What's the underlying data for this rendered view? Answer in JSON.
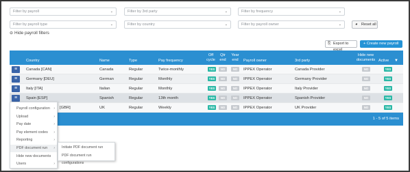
{
  "filters": {
    "payroll": "Filter by payroll",
    "third_party": "Filter by 3rd party",
    "frequency": "Filter by frequency",
    "payroll_type": "Filter by payroll type",
    "country": "Filter by country",
    "owner": "Filter by payroll owner"
  },
  "reset_label": "Reset all",
  "hide_filters_label": "Hide payroll filters",
  "export_label": "Export to excel",
  "create_label": "+ Create new payroll",
  "columns": {
    "country": "Country",
    "name": "Name",
    "type": "Type",
    "frequency": "Pay frequency",
    "off_cycle": "Off cycle",
    "qtr_end": "Qtr end",
    "year_end": "Year end",
    "owner": "Payroll owner",
    "third_party": "3rd party",
    "hide_new_docs": "Hide new documents",
    "active": "Active"
  },
  "rows": [
    {
      "country": "Canada [CAN]",
      "name": "Canada",
      "type": "Regular",
      "frequency": "Twice-monthly",
      "off_cycle": "YES",
      "qtr_end": "NO",
      "year_end": "NO",
      "owner": "IPPEX Operator",
      "third_party": "Canada Provider",
      "hide_new_docs": "NO",
      "active": "YES"
    },
    {
      "country": "Germany [DEU]",
      "name": "German",
      "type": "Regular",
      "frequency": "Monthly",
      "off_cycle": "YES",
      "qtr_end": "NO",
      "year_end": "NO",
      "owner": "IPPEX Operator",
      "third_party": "Germany Provider",
      "hide_new_docs": "NO",
      "active": "YES"
    },
    {
      "country": "Italy [ITA]",
      "name": "Italian",
      "type": "Regular",
      "frequency": "Monthly",
      "off_cycle": "YES",
      "qtr_end": "NO",
      "year_end": "NO",
      "owner": "IPPEX Operator",
      "third_party": "Italy Provider",
      "hide_new_docs": "NO",
      "active": "YES"
    },
    {
      "country": "Spain [ESP]",
      "name": "Spanish",
      "type": "Regular",
      "frequency": "13th month",
      "off_cycle": "YES",
      "qtr_end": "NO",
      "year_end": "NO",
      "owner": "IPPEX Operator",
      "third_party": "Spanish Provider",
      "hide_new_docs": "NO",
      "active": "YES"
    },
    {
      "country": "[GBR]",
      "name": "UK",
      "type": "Regular",
      "frequency": "Weekly",
      "off_cycle": "YES",
      "qtr_end": "NO",
      "year_end": "NO",
      "owner": "IPPEX Operator",
      "third_party": "UK Provider",
      "hide_new_docs": "NO",
      "active": "YES"
    }
  ],
  "pagination": "1 - 5 of 5 items",
  "context_menu": [
    {
      "label": "Payroll configuration",
      "has_sub": true
    },
    {
      "label": "Upload",
      "has_sub": true
    },
    {
      "label": "Pay date",
      "has_sub": true
    },
    {
      "label": "Pay element codes",
      "has_sub": true
    },
    {
      "label": "Reporting",
      "has_sub": true
    },
    {
      "label": "PDF document run",
      "has_sub": true
    },
    {
      "label": "Hide new documents",
      "has_sub": false
    },
    {
      "label": "Users",
      "has_sub": true
    }
  ],
  "submenu": [
    {
      "label": "Initiate PDF document run"
    },
    {
      "label": "PDF document run configurations"
    }
  ],
  "colors": {
    "header": "#2b8fd1",
    "yes": "#2bb8a6",
    "no": "#c6cacf",
    "menu_button": "#3a64a8"
  }
}
